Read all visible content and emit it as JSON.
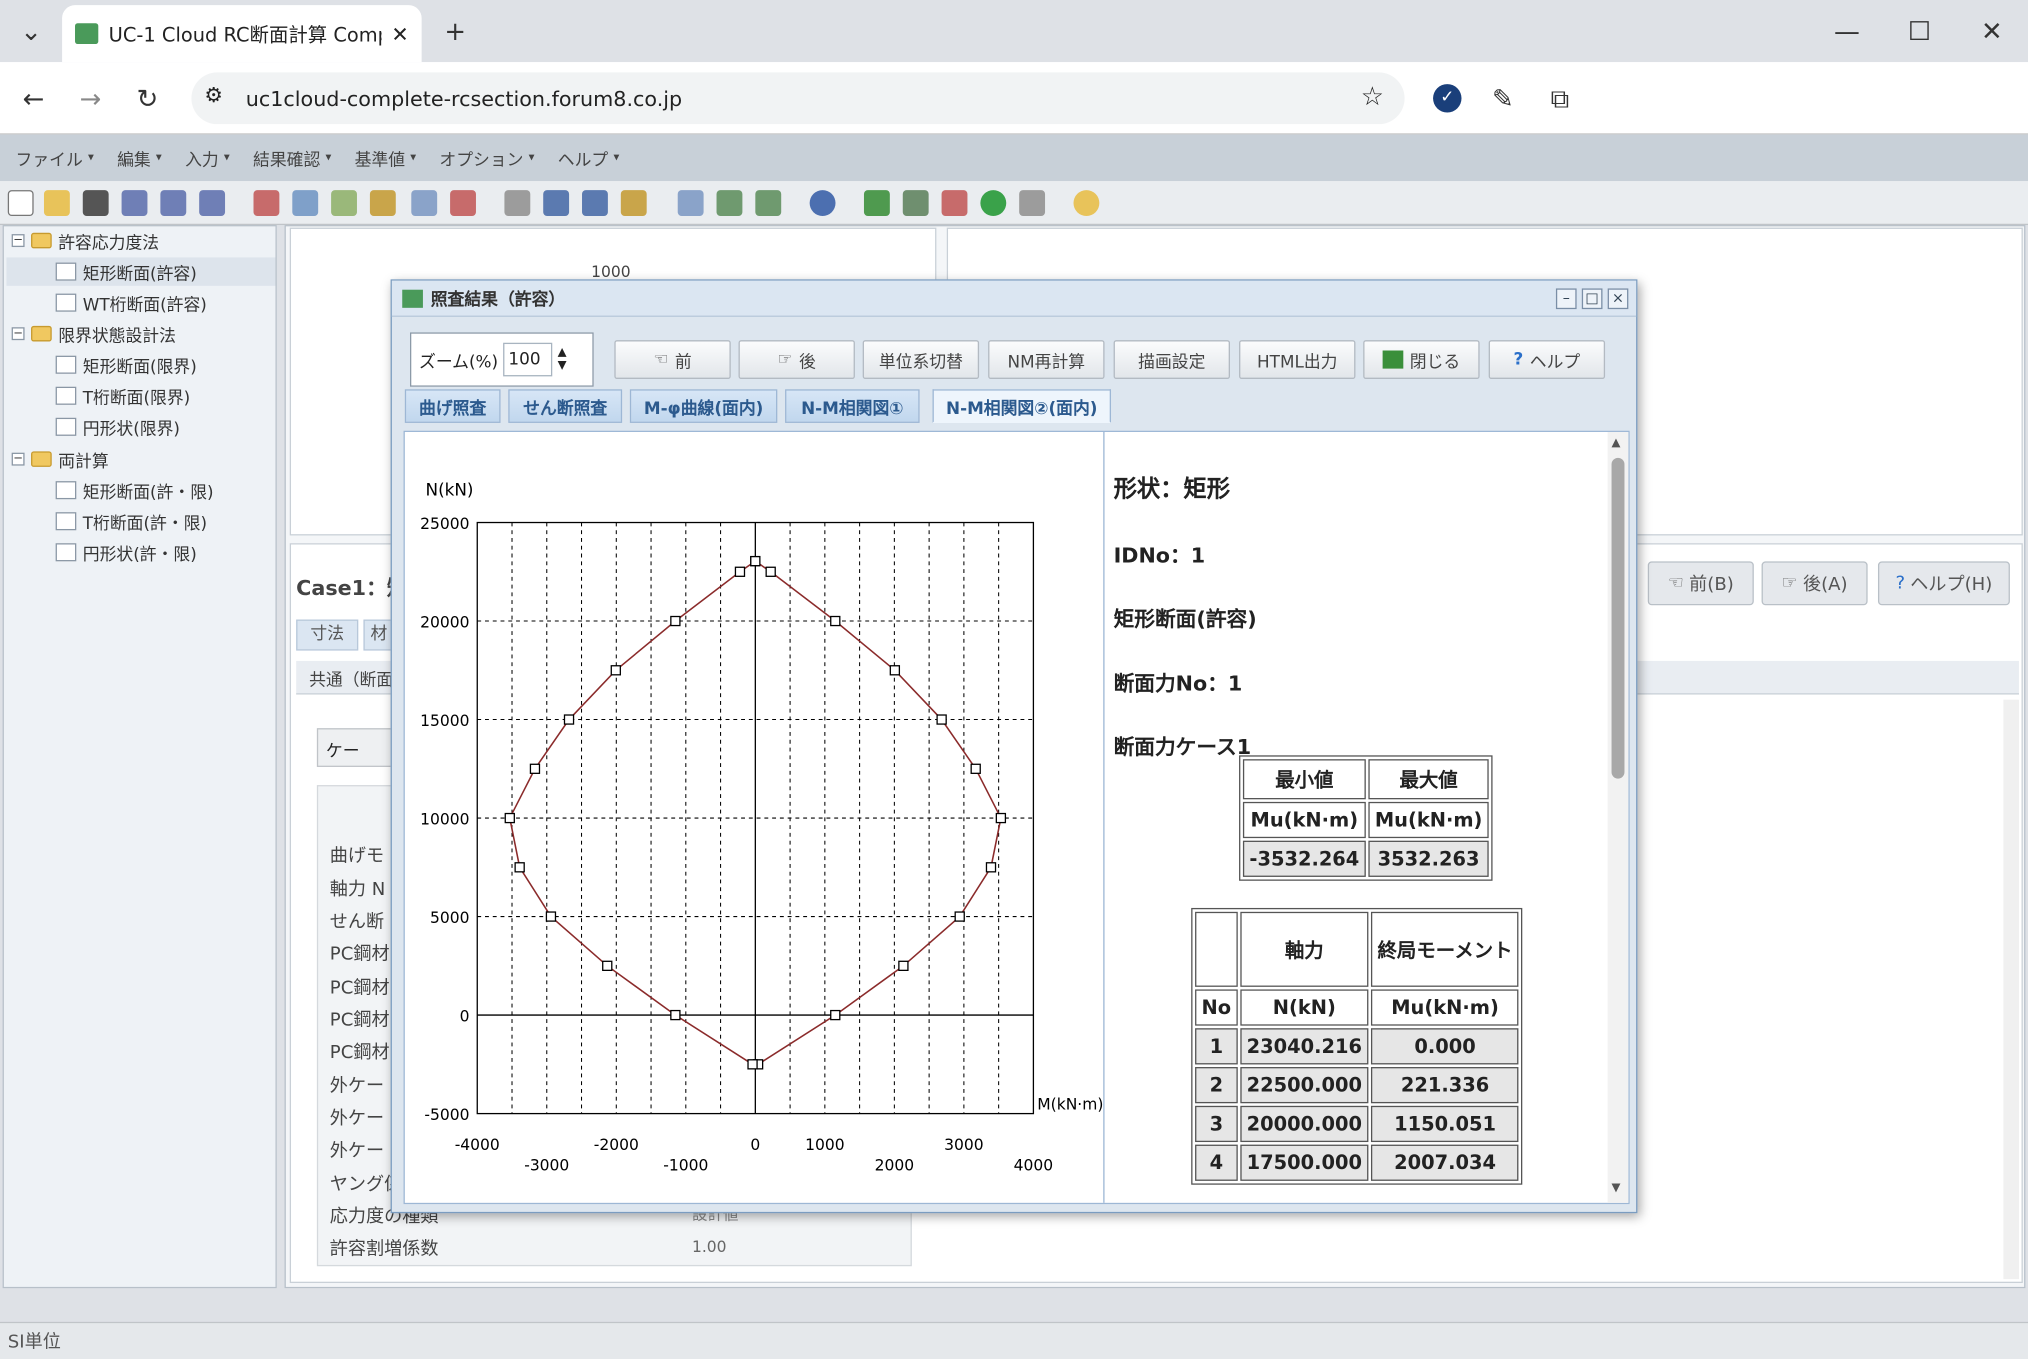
{
  "browser": {
    "tab_title": "UC-1 Cloud RC断面計算 Compl",
    "url": "uc1cloud-complete-rcsection.forum8.co.jp"
  },
  "menu": [
    "ファイル",
    "編集",
    "入力",
    "結果確認",
    "基準値",
    "オプション",
    "ヘルプ"
  ],
  "tree": {
    "groups": [
      {
        "label": "許容応力度法",
        "items": [
          "矩形断面(許容)",
          "WT桁断面(許容)"
        ]
      },
      {
        "label": "限界状態設計法",
        "items": [
          "矩形断面(限界)",
          "T桁断面(限界)",
          "円形状(限界)"
        ]
      },
      {
        "label": "両計算",
        "items": [
          "矩形断面(許・限)",
          "T桁断面(許・限)",
          "円形状(許・限)"
        ]
      }
    ]
  },
  "background": {
    "pane_label": "1000",
    "case_label": "Case1：矩",
    "tab_a": "寸法",
    "tab_b": "材",
    "subtab": "共通（断面",
    "case_button": "ケー",
    "nav_prev": "前(B)",
    "nav_next": "後(A)",
    "nav_help": "ヘルプ(H)",
    "rows": [
      "曲げモ",
      "軸力 N",
      "せん断",
      "PC鋼材",
      "PC鋼材",
      "PC鋼材",
      "PC鋼材",
      "外ケー",
      "外ケー",
      "外ケー",
      "ヤング係",
      "応力度の種類",
      "許容割増係数"
    ],
    "values": {
      "stress_type": "設計値",
      "allow_factor": "1.00"
    },
    "status": "SI単位"
  },
  "dialog": {
    "title": "照査結果（許容）",
    "zoom_label": "ズーム(%)",
    "zoom_value": "100",
    "buttons": {
      "prev": "前",
      "next": "後",
      "unit": "単位系切替",
      "nm": "NM再計算",
      "draw": "描画設定",
      "html": "HTML出力",
      "close": "閉じる",
      "help": "ヘルプ"
    },
    "tabs": [
      "曲げ照査",
      "せん断照査",
      "M-φ曲線(面内)",
      "N-M相関図①",
      "N-M相関図②(面内)"
    ],
    "active_tab": 4
  },
  "report": {
    "shape": "形状：矩形",
    "idno": "IDNo：1",
    "section": "矩形断面(許容)",
    "force_no": "断面力No：1",
    "force_case": "断面力ケース1",
    "minmax": {
      "headers": [
        "最小値",
        "最大値"
      ],
      "units": [
        "Mu(kN·m)",
        "Mu(kN·m)"
      ],
      "values": [
        "-3532.264",
        "3532.263"
      ]
    },
    "table": {
      "h1": [
        "",
        "軸力",
        "終局モーメント"
      ],
      "h2": [
        "No",
        "N(kN)",
        "Mu(kN·m)"
      ],
      "rows": [
        [
          "1",
          "23040.216",
          "0.000"
        ],
        [
          "2",
          "22500.000",
          "221.336"
        ],
        [
          "3",
          "20000.000",
          "1150.051"
        ],
        [
          "4",
          "17500.000",
          "2007.034"
        ]
      ]
    }
  },
  "chart_data": {
    "type": "scatter",
    "ylabel": "N(kN)",
    "xlabel": "M(kN·m)",
    "xlim": [
      -4000,
      4000
    ],
    "ylim": [
      -5000,
      25000
    ],
    "x_ticks_upper": [
      "-4000",
      "-2000",
      "0",
      "1000",
      "3000"
    ],
    "x_ticks_lower": [
      "-3000",
      "-1000",
      "2000",
      "4000"
    ],
    "y_ticks": [
      "25000",
      "20000",
      "15000",
      "10000",
      "5000",
      "0",
      "-5000"
    ],
    "x_tick_values_upper": [
      -4000,
      -2000,
      0,
      1000,
      3000
    ],
    "x_tick_values_lower": [
      -3000,
      -1000,
      2000,
      4000
    ],
    "y_tick_values": [
      25000,
      20000,
      15000,
      10000,
      5000,
      0,
      -5000
    ],
    "series": [
      {
        "points": [
          [
            0,
            23040
          ],
          [
            221,
            22500
          ],
          [
            1150,
            20000
          ],
          [
            2007,
            17500
          ],
          [
            2680,
            15000
          ],
          [
            3170,
            12500
          ],
          [
            3532,
            10000
          ],
          [
            3390,
            7500
          ],
          [
            2940,
            5000
          ],
          [
            2130,
            2500
          ],
          [
            1150,
            0
          ],
          [
            40,
            -2500
          ],
          [
            -40,
            -2500
          ],
          [
            -1150,
            0
          ],
          [
            -2130,
            2500
          ],
          [
            -2940,
            5000
          ],
          [
            -3390,
            7500
          ],
          [
            -3532,
            10000
          ],
          [
            -3170,
            12500
          ],
          [
            -2680,
            15000
          ],
          [
            -2007,
            17500
          ],
          [
            -1150,
            20000
          ],
          [
            -221,
            22500
          ],
          [
            0,
            23040
          ]
        ]
      }
    ],
    "grid": true,
    "line_color": "#8b2b2b"
  }
}
